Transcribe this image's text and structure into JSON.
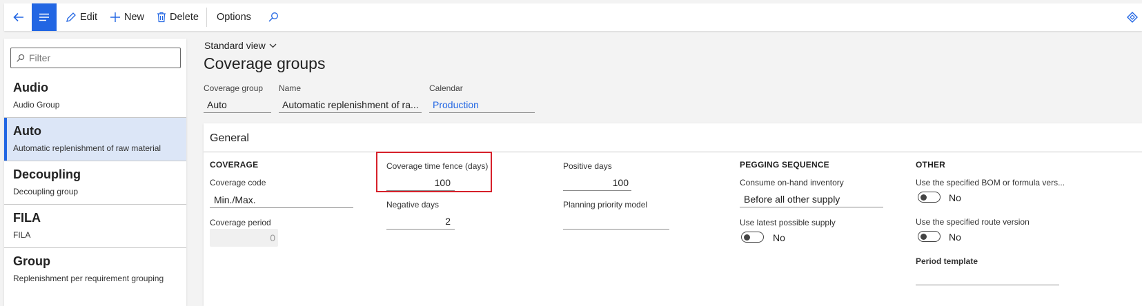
{
  "toolbar": {
    "edit_label": "Edit",
    "new_label": "New",
    "delete_label": "Delete",
    "options_label": "Options",
    "accent": "#2266e3"
  },
  "filter": {
    "placeholder": "Filter"
  },
  "list": {
    "items": [
      {
        "title": "Audio",
        "subtitle": "Audio Group",
        "selected": false
      },
      {
        "title": "Auto",
        "subtitle": "Automatic replenishment of raw material",
        "selected": true
      },
      {
        "title": "Decoupling",
        "subtitle": "Decoupling group",
        "selected": false
      },
      {
        "title": "FILA",
        "subtitle": "FILA",
        "selected": false
      },
      {
        "title": "Group",
        "subtitle": "Replenishment per requirement grouping",
        "selected": false
      }
    ]
  },
  "header": {
    "view": "Standard view",
    "title": "Coverage groups",
    "fields": {
      "coverage_group": {
        "label": "Coverage group",
        "value": "Auto"
      },
      "name": {
        "label": "Name",
        "value": "Automatic replenishment of ra..."
      },
      "calendar": {
        "label": "Calendar",
        "value": "Production"
      }
    }
  },
  "general": {
    "title": "General",
    "coverage": {
      "heading": "COVERAGE",
      "code_label": "Coverage code",
      "code_value": "Min./Max.",
      "period_label": "Coverage period",
      "period_value": "0"
    },
    "fence": {
      "time_fence_label": "Coverage time fence (days)",
      "time_fence_value": "100",
      "negative_label": "Negative days",
      "negative_value": "2"
    },
    "positive": {
      "positive_label": "Positive days",
      "positive_value": "100",
      "priority_label": "Planning priority model",
      "priority_value": ""
    },
    "pegging": {
      "heading": "PEGGING SEQUENCE",
      "consume_label": "Consume on-hand inventory",
      "consume_value": "Before all other supply",
      "latest_label": "Use latest possible supply",
      "latest_value": "No"
    },
    "other": {
      "heading": "OTHER",
      "bom_label": "Use the specified BOM or formula vers...",
      "bom_value": "No",
      "route_label": "Use the specified route version",
      "route_value": "No",
      "period_template_label": "Period template",
      "period_template_value": ""
    }
  }
}
